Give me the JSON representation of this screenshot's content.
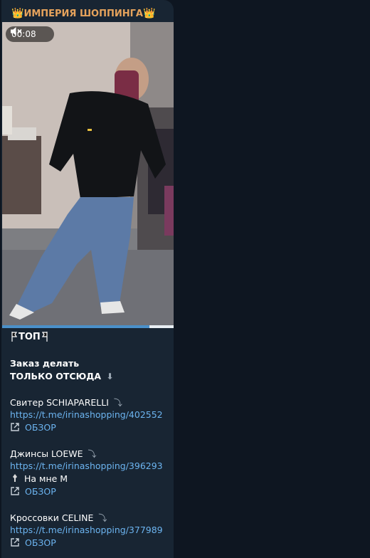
{
  "channel": {
    "name": "ИМПЕРИЯ ШОППИНГА",
    "crown": "👑"
  },
  "video": {
    "duration": "00:08",
    "progress": 0.86
  },
  "post": {
    "tag": "ТОП",
    "order_line1": "Заказ делать",
    "order_line2": "ТОЛЬКО ОТСЮДА",
    "down_arrow": "⬇",
    "items": [
      {
        "title": "Свитер SCHIAPARELLI",
        "url": "https://t.me/irinashopping/402552",
        "review": "ОБЗОР"
      },
      {
        "title": "Джинсы LOEWE",
        "url": "https://t.me/irinashopping/396293",
        "note": "На мне М",
        "review": "ОБЗОР"
      },
      {
        "title": "Кроссовки CELINE",
        "url": "https://t.me/irinashopping/377989",
        "review": "ОБЗОР"
      }
    ],
    "curve_arrow": "⤵"
  },
  "colors": {
    "background": "#0e1621",
    "bubble": "#182533",
    "channel": "#e6a35c",
    "link": "#6cb4f0"
  }
}
